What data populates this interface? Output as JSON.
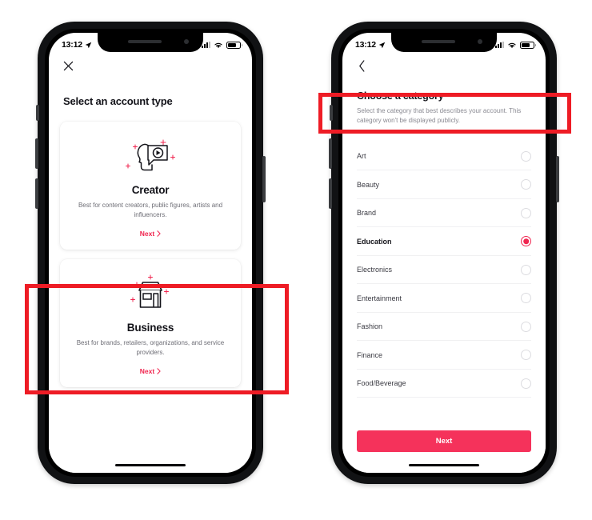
{
  "meta": {
    "accent_pink": "#f0254f",
    "button_pink": "#f5325b",
    "annotation_red": "#ee1c25",
    "text_dark": "#14141a",
    "text_muted": "#6e6e76"
  },
  "status_bar": {
    "time": "13:12",
    "location_icon": "location-arrow-icon",
    "signal_icon": "cellular-signal-icon",
    "wifi_icon": "wifi-icon",
    "battery_icon": "battery-icon"
  },
  "phone_left": {
    "nav": {
      "close_icon": "close-x-icon"
    },
    "title": "Select an account type",
    "cards": [
      {
        "icon": "creator-head-video-icon",
        "title": "Creator",
        "description": "Best for content creators, public figures, artists and influencers.",
        "next_label": "Next",
        "next_chevron": "chevron-right-icon"
      },
      {
        "icon": "business-storefront-icon",
        "title": "Business",
        "description": "Best for brands, retailers, organizations, and service providers.",
        "next_label": "Next",
        "next_chevron": "chevron-right-icon"
      }
    ]
  },
  "phone_right": {
    "nav": {
      "back_icon": "chevron-left-back-icon"
    },
    "title": "Choose a category",
    "subtitle": "Select the category that best describes your account. This category won't be displayed publicly.",
    "categories": [
      {
        "label": "Art",
        "selected": false
      },
      {
        "label": "Beauty",
        "selected": false
      },
      {
        "label": "Brand",
        "selected": false
      },
      {
        "label": "Education",
        "selected": true
      },
      {
        "label": "Electronics",
        "selected": false
      },
      {
        "label": "Entertainment",
        "selected": false
      },
      {
        "label": "Fashion",
        "selected": false
      },
      {
        "label": "Finance",
        "selected": false
      },
      {
        "label": "Food/Beverage",
        "selected": false
      }
    ],
    "primary_button": "Next"
  },
  "annotations": [
    {
      "name": "business-card-highlight",
      "target": "Business"
    },
    {
      "name": "choose-a-category-highlight",
      "target": "Choose a category"
    }
  ]
}
